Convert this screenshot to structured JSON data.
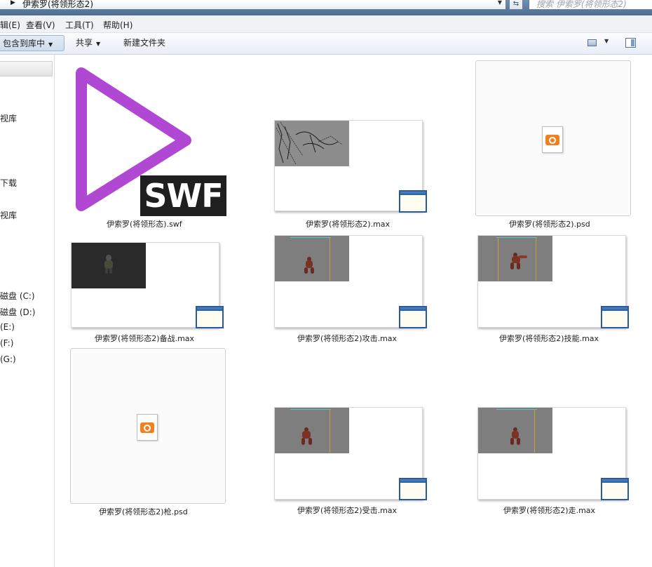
{
  "address_bar": {
    "path": "伊索罗(将领形态2)"
  },
  "search": {
    "placeholder": "搜索 伊索罗(将领形态2)"
  },
  "menu": {
    "items": [
      "辑(E)",
      "查看(V)",
      "工具(T)",
      "帮助(H)"
    ]
  },
  "toolbar": {
    "include_library": "包含到库中",
    "share": "共享",
    "new_folder": "新建文件夹"
  },
  "nav": {
    "items": [
      "视库",
      "下载",
      "视库",
      "磁盘 (C:)",
      "磁盘 (D:)",
      "(E:)",
      "(F:)",
      "(G:)"
    ]
  },
  "files": [
    {
      "name": "伊索罗(将领形态).swf",
      "kind": "swf",
      "badge": "SWF"
    },
    {
      "name": "伊索罗(将领形态2).max",
      "kind": "max"
    },
    {
      "name": "伊索罗(将领形态2).psd",
      "kind": "psd"
    },
    {
      "name": "伊索罗(将领形态2)备战.max",
      "kind": "max"
    },
    {
      "name": "伊索罗(将领形态2)攻击.max",
      "kind": "max"
    },
    {
      "name": "伊索罗(将领形态2)技能.max",
      "kind": "max"
    },
    {
      "name": "伊索罗(将领形态2)枪.psd",
      "kind": "psd"
    },
    {
      "name": "伊索罗(将领形态2)受击.max",
      "kind": "max"
    },
    {
      "name": "伊索罗(将领形态2)走.max",
      "kind": "max"
    }
  ],
  "colors": {
    "swf_play_stroke": "#b048d4",
    "swf_badge_bg": "#1f1f1f",
    "psd_accent": "#f1801e",
    "window_icon_blue": "#2b5a9a"
  },
  "icons": {
    "address_arrow": "chevron-right-icon",
    "dropdown": "chevron-down-icon",
    "refresh": "refresh-icon",
    "view": "view-options-icon",
    "preview_pane": "preview-pane-icon",
    "swf": "play-icon",
    "psd": "photoshop-file-icon",
    "max_app": "window-app-icon"
  }
}
